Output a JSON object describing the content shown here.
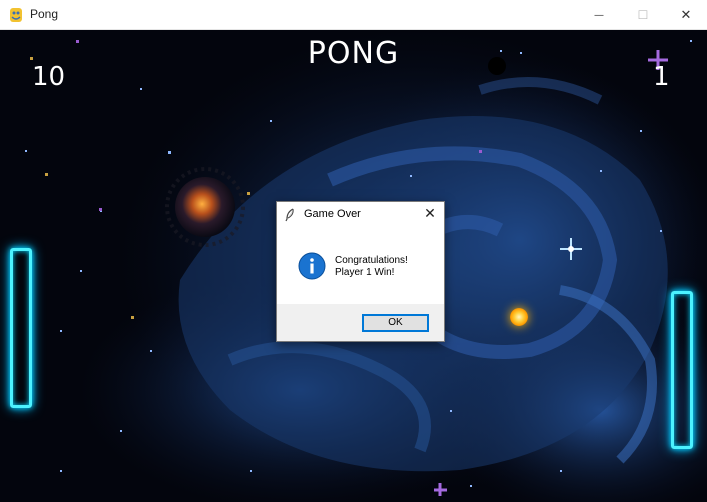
{
  "window": {
    "title": "Pong",
    "controls": {
      "minimize": "—",
      "maximize": "☐",
      "close": "✕"
    }
  },
  "game": {
    "title": "PONG",
    "scores": {
      "left": "10",
      "right": "1"
    }
  },
  "dialog": {
    "title": "Game Over",
    "close_glyph": "✕",
    "message_line1": "Congratulations!",
    "message_line2": "Player 1 Win!",
    "ok_label": "OK",
    "icon": "information-icon"
  },
  "colors": {
    "paddle_glow": "#4cf2ff",
    "ball": "#ffcf3a",
    "background": "#03050d",
    "nebula": "#1e3d73",
    "dialog_accent": "#0078d7"
  }
}
